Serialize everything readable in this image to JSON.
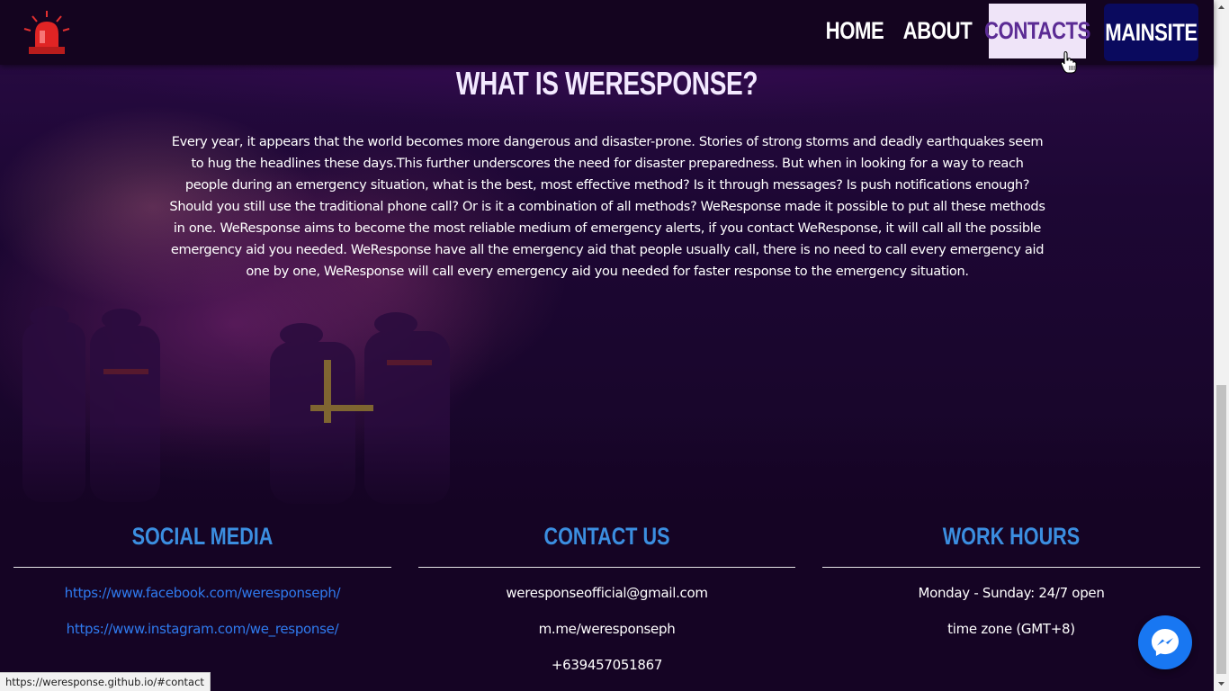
{
  "navbar": {
    "logo_icon": "siren-icon",
    "links": [
      {
        "label": "HOME"
      },
      {
        "label": "ABOUT"
      },
      {
        "label": "CONTACTS",
        "state": "hovered"
      },
      {
        "label": "MAINSITE"
      }
    ]
  },
  "hero": {
    "title": "WHAT IS WERESPONSE?",
    "paragraph": "Every year, it appears that the world becomes more dangerous and disaster-prone. Stories of strong storms and deadly earthquakes seem to hug the headlines these days.This further underscores the need for disaster preparedness. But when in looking for a way to reach people during an emergency situation, what is the best, most effective method? Is it through messages? Is push notifications enough? Should you still use the traditional phone call? Or is it a combination of all methods? WeResponse made it possible to put all these methods in one. WeResponse aims to become the most reliable medium of emergency alerts, if you contact WeResponse, it will call all the possible emergency aid you needed. WeResponse have all the emergency aid that people usually call, there is no need to call every emergency aid one by one, WeResponse will call every emergency aid you needed for faster response to the emergency situation."
  },
  "footer": {
    "social": {
      "heading": "SOCIAL MEDIA",
      "links": [
        "https://www.facebook.com/weresponseph/",
        "https://www.instagram.com/we_response/"
      ]
    },
    "contact": {
      "heading": "CONTACT US",
      "items": [
        "weresponseofficial@gmail.com",
        "m.me/weresponseph",
        "+639457051867"
      ]
    },
    "hours": {
      "heading": "WORK HOURS",
      "items": [
        "Monday - Sunday: 24/7 open",
        "time zone (GMT+8)"
      ]
    }
  },
  "messenger": {
    "icon": "messenger-icon"
  },
  "status_bar": {
    "url": "https://weresponse.github.io/#contact"
  },
  "colors": {
    "nav_bg": "#14041f",
    "page_bg": "#150424",
    "heading_blue": "#3b8ee0",
    "link_blue": "#2f7bf0",
    "contacts_hover_bg": "#efe4f8",
    "contacts_hover_text": "#5b2b94",
    "mainsite_bg": "#0a0a5e",
    "messenger_blue": "#1877f2"
  }
}
